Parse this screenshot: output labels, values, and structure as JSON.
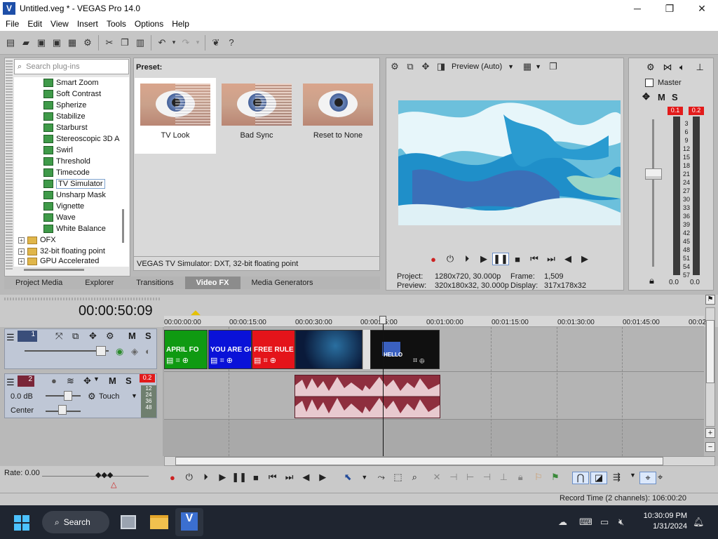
{
  "window": {
    "title": "Untitled.veg * - VEGAS Pro 14.0",
    "logo": "V"
  },
  "window_controls": {
    "minimize": "─",
    "maximize": "❐",
    "close": "✕"
  },
  "menu": [
    "File",
    "Edit",
    "View",
    "Insert",
    "Tools",
    "Options",
    "Help"
  ],
  "plugins": {
    "search_placeholder": "Search plug-ins",
    "items": [
      "Smart Zoom",
      "Soft Contrast",
      "Spherize",
      "Stabilize",
      "Starburst",
      "Stereoscopic 3D A",
      "Swirl",
      "Threshold",
      "Timecode",
      "TV Simulator",
      "Unsharp Mask",
      "Vignette",
      "Wave",
      "White Balance"
    ],
    "selected": "TV Simulator",
    "folders": [
      "OFX",
      "32-bit floating point",
      "GPU Accelerated"
    ]
  },
  "preset": {
    "title": "Preset:",
    "items": [
      "TV Look",
      "Bad Sync",
      "Reset to None"
    ],
    "status": "VEGAS TV Simulator: DXT, 32-bit floating point"
  },
  "dock_tabs": [
    "Project Media",
    "Explorer",
    "Transitions",
    "Video FX",
    "Media Generators"
  ],
  "dock_active": "Video FX",
  "preview": {
    "mode": "Preview (Auto)",
    "project_label": "Project:",
    "project_value": "1280x720, 30.000p",
    "preview_label": "Preview:",
    "preview_value": "320x180x32, 30.000p",
    "frame_label": "Frame:",
    "frame_value": "1,509",
    "display_label": "Display:",
    "display_value": "317x178x32"
  },
  "master": {
    "title": "Master",
    "peak_left": "0.1",
    "peak_right": "0.2",
    "scale": [
      "3",
      "6",
      "9",
      "12",
      "15",
      "18",
      "21",
      "24",
      "27",
      "30",
      "33",
      "36",
      "39",
      "42",
      "45",
      "48",
      "51",
      "54",
      "57"
    ],
    "level_left": "0.0",
    "level_right": "0.0",
    "m_label": "M",
    "s_label": "S"
  },
  "timeline": {
    "time": "00:00:50:09",
    "ruler": [
      "00:00:00:00",
      "00:00:15:00",
      "00:00:30:00",
      "00:00:45:00",
      "00:01:00:00",
      "00:01:15:00",
      "00:01:30:00",
      "00:01:45:00",
      "00:02"
    ],
    "clips": [
      {
        "text": "APRIL FO",
        "color": "#0f9a12"
      },
      {
        "text": "YOU ARE GO",
        "color": "#0a12d8"
      },
      {
        "text": "FREE RULE",
        "color": "#e4141a"
      }
    ],
    "clip_hello": "HELLO"
  },
  "track1": {
    "number": "1",
    "m": "M",
    "s": "S"
  },
  "track2": {
    "number": "2",
    "m": "M",
    "s": "S",
    "db": "0.0 dB",
    "pan": "Center",
    "mode": "Touch",
    "peak": "0.2",
    "meter": [
      "12",
      "24",
      "36",
      "48"
    ]
  },
  "bottom": {
    "rate": "Rate: 0.00"
  },
  "statusbar": {
    "record_time": "Record Time (2 channels): 106:00:20"
  },
  "taskbar": {
    "search": "Search",
    "time": "10:30:09 PM",
    "date": "1/31/2024"
  }
}
